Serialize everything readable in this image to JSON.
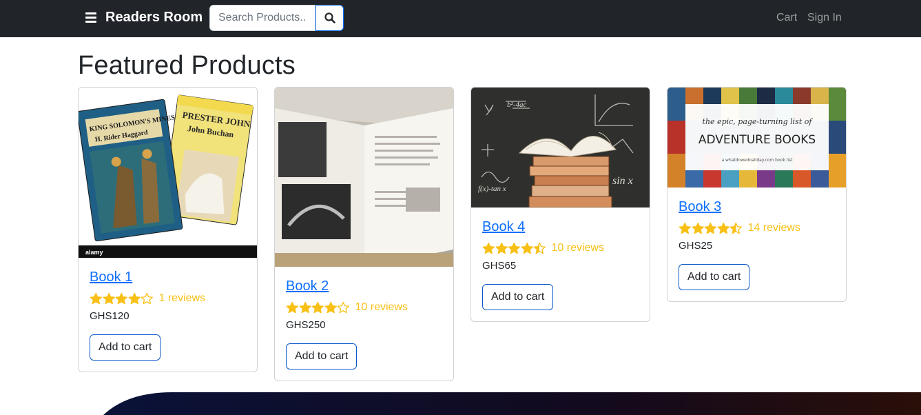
{
  "navbar": {
    "brand": "Readers Room",
    "search_placeholder": "Search Products...",
    "links": {
      "cart": "Cart",
      "sign_in": "Sign In"
    }
  },
  "page": {
    "title": "Featured Products"
  },
  "products": [
    {
      "name": "Book 1",
      "rating": 4,
      "reviews": "1 reviews",
      "price": "GHS120",
      "button": "Add to cart",
      "cover_title_1": "KING SOLOMON'S MINES",
      "cover_author_1": "H. Rider Haggard",
      "cover_title_2": "PRESTER JOHN",
      "cover_author_2": "John Buchan",
      "watermark": "alamy"
    },
    {
      "name": "Book 2",
      "rating": 4,
      "reviews": "10 reviews",
      "price": "GHS250",
      "button": "Add to cart"
    },
    {
      "name": "Book 4",
      "rating": 4.5,
      "reviews": "10 reviews",
      "price": "GHS65",
      "button": "Add to cart",
      "chalk_text": "sin x"
    },
    {
      "name": "Book 3",
      "rating": 4.5,
      "reviews": "14 reviews",
      "price": "GHS25",
      "button": "Add to cart",
      "banner_line_1": "the epic, page-turning list of",
      "banner_line_2": "ADVENTURE BOOKS",
      "banner_line_3": "a whatdowedoallday.com book list"
    }
  ],
  "colors": {
    "navbar": "#212529",
    "link": "#0d6efd",
    "star": "#f8c016",
    "button_border": "#0a58ca"
  },
  "icons": {
    "menu": "hamburger-icon",
    "search": "search-icon",
    "star": "star-icon"
  }
}
